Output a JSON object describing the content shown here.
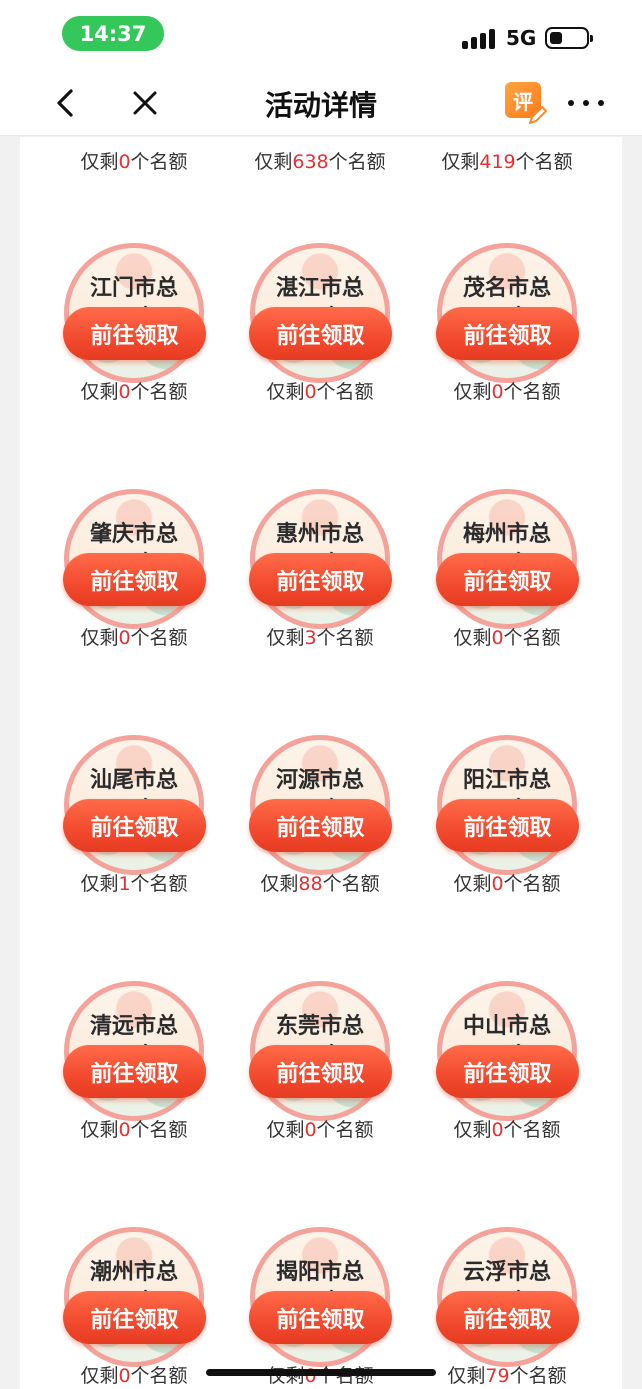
{
  "status_bar": {
    "time": "14:37",
    "network": "5G"
  },
  "nav": {
    "title": "活动详情",
    "review_label": "评"
  },
  "quota_text": {
    "prefix": "仅剩",
    "suffix": "个名额"
  },
  "button_label": "前往领取",
  "top_quotas": [
    "0",
    "638",
    "419"
  ],
  "rows": [
    {
      "cells": [
        {
          "name_line1": "江门市总",
          "name_line2": "工会",
          "remaining": "0"
        },
        {
          "name_line1": "湛江市总",
          "name_line2": "工会",
          "remaining": "0"
        },
        {
          "name_line1": "茂名市总",
          "name_line2": "工会",
          "remaining": "0"
        }
      ]
    },
    {
      "cells": [
        {
          "name_line1": "肇庆市总",
          "name_line2": "工会",
          "remaining": "0"
        },
        {
          "name_line1": "惠州市总",
          "name_line2": "工会",
          "remaining": "3"
        },
        {
          "name_line1": "梅州市总",
          "name_line2": "工会",
          "remaining": "0"
        }
      ]
    },
    {
      "cells": [
        {
          "name_line1": "汕尾市总",
          "name_line2": "工会",
          "remaining": "1"
        },
        {
          "name_line1": "河源市总",
          "name_line2": "工会",
          "remaining": "88"
        },
        {
          "name_line1": "阳江市总",
          "name_line2": "工会",
          "remaining": "0"
        }
      ]
    },
    {
      "cells": [
        {
          "name_line1": "清远市总",
          "name_line2": "工会",
          "remaining": "0"
        },
        {
          "name_line1": "东莞市总",
          "name_line2": "工会",
          "remaining": "0"
        },
        {
          "name_line1": "中山市总",
          "name_line2": "工会",
          "remaining": "0"
        }
      ]
    },
    {
      "cells": [
        {
          "name_line1": "潮州市总",
          "name_line2": "工会",
          "remaining": "0"
        },
        {
          "name_line1": "揭阳市总",
          "name_line2": "工会",
          "remaining": "0"
        },
        {
          "name_line1": "云浮市总",
          "name_line2": "工会",
          "remaining": "79"
        }
      ]
    }
  ],
  "colors": {
    "accent_red": "#e63030",
    "button_gradient_top": "#ff6b4a",
    "time_pill": "#34c759",
    "review_orange": "#ff8a25"
  },
  "icons": [
    "back-arrow-icon",
    "close-icon",
    "review-icon",
    "more-icon",
    "signal-icon",
    "battery-icon"
  ]
}
